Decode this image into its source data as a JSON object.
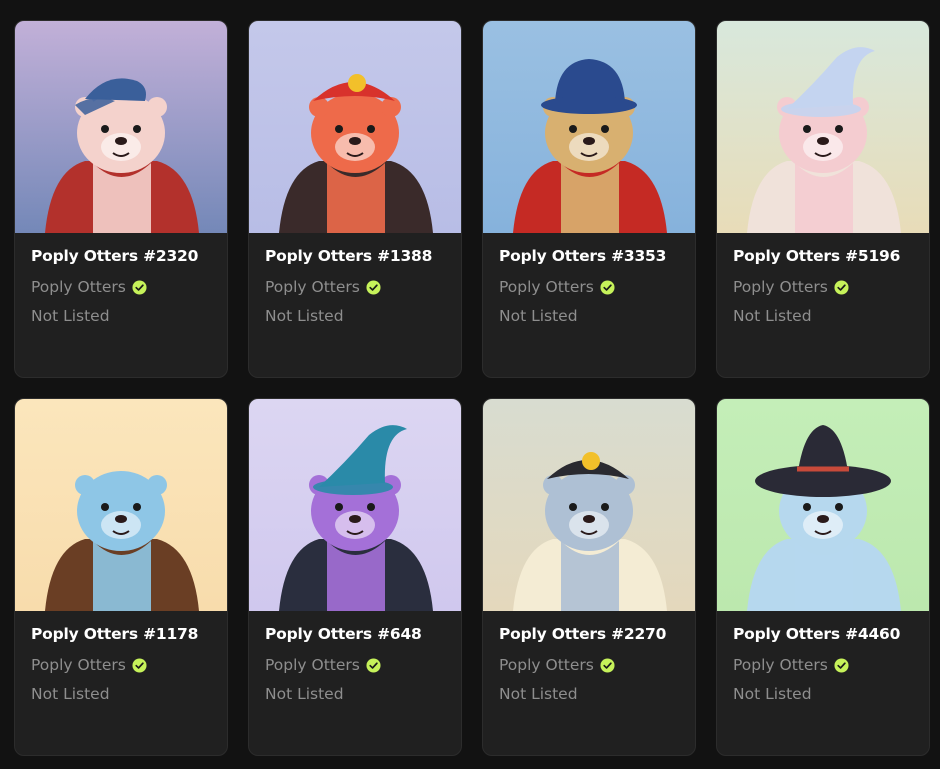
{
  "cards": [
    {
      "title": "Poply Otters #2320",
      "collection": "Poply Otters",
      "status": "Not Listed",
      "bg1": "#c2b0d8",
      "bg2": "#7488b8",
      "fur": "#f4d2cc",
      "outfit": "#b3312c",
      "hat": "#3a5f9a",
      "hat_type": "cap"
    },
    {
      "title": "Poply Otters #1388",
      "collection": "Poply Otters",
      "status": "Not Listed",
      "bg1": "#c4c8ea",
      "bg2": "#b8bde6",
      "fur": "#ee6a4a",
      "outfit": "#3a2a2a",
      "hat": "#d8322c",
      "hat_type": "bandana"
    },
    {
      "title": "Poply Otters #3353",
      "collection": "Poply Otters",
      "status": "Not Listed",
      "bg1": "#9ac0e2",
      "bg2": "#86b2dc",
      "fur": "#d8b070",
      "outfit": "#c52a24",
      "hat": "#2a4a8e",
      "hat_type": "bucket"
    },
    {
      "title": "Poply Otters #5196",
      "collection": "Poply Otters",
      "status": "Not Listed",
      "bg1": "#d8e8dc",
      "bg2": "#e8dcb8",
      "fur": "#f4ccd0",
      "outfit": "#f0e2da",
      "hat": "#c4d4f0",
      "hat_type": "wizard"
    },
    {
      "title": "Poply Otters #1178",
      "collection": "Poply Otters",
      "status": "Not Listed",
      "bg1": "#fbe6bc",
      "bg2": "#f8dcac",
      "fur": "#8ec6e6",
      "outfit": "#6a3e24",
      "hat": "none",
      "hat_type": "none"
    },
    {
      "title": "Poply Otters #648",
      "collection": "Poply Otters",
      "status": "Not Listed",
      "bg1": "#dcd6f2",
      "bg2": "#d0c8ee",
      "fur": "#a470d8",
      "outfit": "#2a2e3e",
      "hat": "#2a8aa8",
      "hat_type": "wizard"
    },
    {
      "title": "Poply Otters #2270",
      "collection": "Poply Otters",
      "status": "Not Listed",
      "bg1": "#d8dcd0",
      "bg2": "#e4d8bc",
      "fur": "#aec0d4",
      "outfit": "#f4ecd4",
      "hat": "#2a2a30",
      "hat_type": "bandana"
    },
    {
      "title": "Poply Otters #4460",
      "collection": "Poply Otters",
      "status": "Not Listed",
      "bg1": "#c4eeb8",
      "bg2": "#bce8ae",
      "fur": "#b6d8ee",
      "outfit": "#b6d8ee",
      "hat": "#2a2a36",
      "hat_type": "sombrero"
    }
  ],
  "colors": {
    "verified": "#c6f25a",
    "card_bg": "#202020",
    "page_bg": "#121212"
  }
}
